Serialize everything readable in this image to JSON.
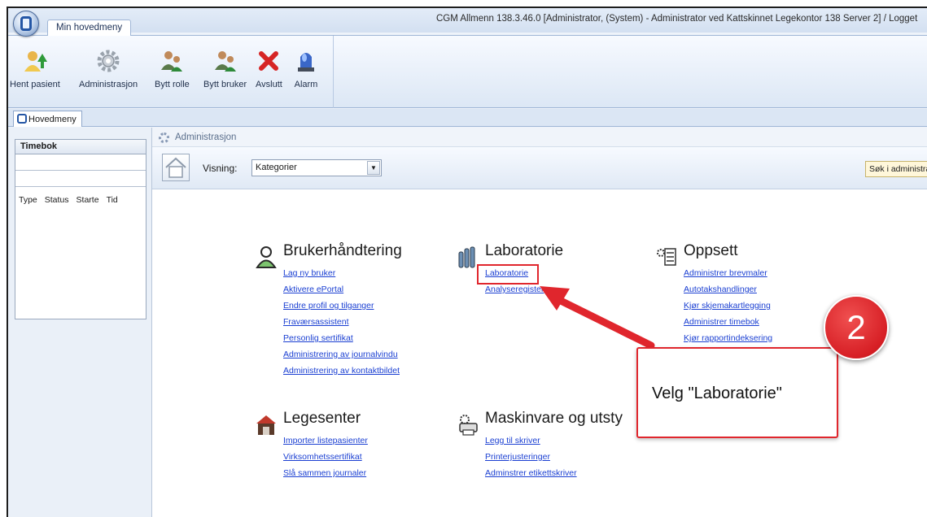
{
  "window": {
    "title": "CGM Allmenn 138.3.46.0 [Administrator, (System) - Administrator ved Kattskinnet Legekontor 138 Server 2] / Logget",
    "ribbon_tab": "Min hovedmeny"
  },
  "ribbon": {
    "buttons": [
      {
        "label": "Hent pasient",
        "icon": "person-arrow-icon"
      },
      {
        "label": "Administrasjon",
        "icon": "gear-icon"
      },
      {
        "label": "Bytt rolle",
        "icon": "users-swap-icon"
      },
      {
        "label": "Bytt bruker",
        "icon": "users-swap-icon"
      },
      {
        "label": "Avslutt",
        "icon": "close-x-icon"
      },
      {
        "label": "Alarm",
        "icon": "alarm-light-icon"
      }
    ]
  },
  "doc_tab": "Hovedmeny",
  "timebok": {
    "title": "Timebok",
    "columns": [
      "Type",
      "Status",
      "Starte",
      "Tid"
    ]
  },
  "admin": {
    "title": "Administrasjon",
    "visning_label": "Visning:",
    "visning_value": "Kategorier",
    "search_text": "Søk i administra"
  },
  "categories": {
    "brukerhandtering": {
      "title": "Brukerhåndtering",
      "links": [
        "Lag ny bruker",
        "Aktivere ePortal",
        "Endre profil og tilganger",
        "Fraværsassistent",
        "Personlig sertifikat",
        "Administrering av journalvindu",
        "Administrering av kontaktbildet"
      ]
    },
    "laboratorie": {
      "title": "Laboratorie",
      "links": [
        "Laboratorie",
        "Analyseregister"
      ]
    },
    "oppsett": {
      "title": "Oppsett",
      "links": [
        "Administrer brevmaler",
        "Autotakshandlinger",
        "Kjør skjemakartlegging",
        "Administrer timebok",
        "Kjør rapportindeksering"
      ]
    },
    "legesenter": {
      "title": "Legesenter",
      "links": [
        "Importer listepasienter",
        "Virksomhetssertifikat",
        "Slå sammen journaler"
      ]
    },
    "maskinvare": {
      "title": "Maskinvare og utsty",
      "links": [
        "Legg til skriver",
        "Printerjusteringer",
        "Adminstrer etikettskriver"
      ]
    }
  },
  "annotation": {
    "step": "2",
    "callout": "Velg \"Laboratorie\"",
    "color": "#e0262d"
  }
}
